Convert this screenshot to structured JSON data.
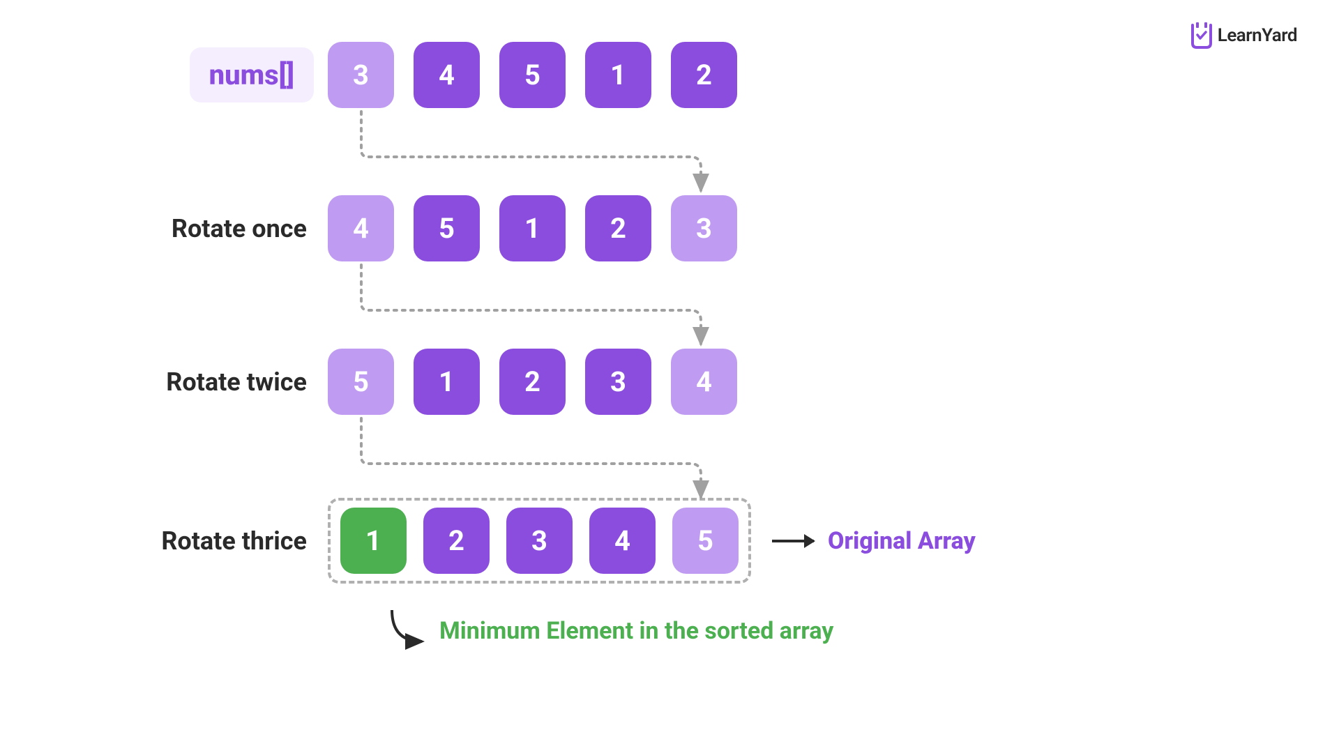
{
  "logo": {
    "text": "LearnYard"
  },
  "rows": [
    {
      "label": "nums[]",
      "labelType": "badge",
      "boxes": [
        {
          "value": "3",
          "style": "light"
        },
        {
          "value": "4",
          "style": "dark"
        },
        {
          "value": "5",
          "style": "dark"
        },
        {
          "value": "1",
          "style": "dark"
        },
        {
          "value": "2",
          "style": "dark"
        }
      ]
    },
    {
      "label": "Rotate once",
      "labelType": "plain",
      "boxes": [
        {
          "value": "4",
          "style": "light"
        },
        {
          "value": "5",
          "style": "dark"
        },
        {
          "value": "1",
          "style": "dark"
        },
        {
          "value": "2",
          "style": "dark"
        },
        {
          "value": "3",
          "style": "light"
        }
      ]
    },
    {
      "label": "Rotate twice",
      "labelType": "plain",
      "boxes": [
        {
          "value": "5",
          "style": "light"
        },
        {
          "value": "1",
          "style": "dark"
        },
        {
          "value": "2",
          "style": "dark"
        },
        {
          "value": "3",
          "style": "dark"
        },
        {
          "value": "4",
          "style": "light"
        }
      ]
    },
    {
      "label": "Rotate thrice",
      "labelType": "plain",
      "dashed": true,
      "boxes": [
        {
          "value": "1",
          "style": "green"
        },
        {
          "value": "2",
          "style": "dark"
        },
        {
          "value": "3",
          "style": "dark"
        },
        {
          "value": "4",
          "style": "dark"
        },
        {
          "value": "5",
          "style": "light"
        }
      ]
    }
  ],
  "annotations": {
    "originalArray": "Original Array",
    "minimumElement": "Minimum Element in the sorted array"
  }
}
